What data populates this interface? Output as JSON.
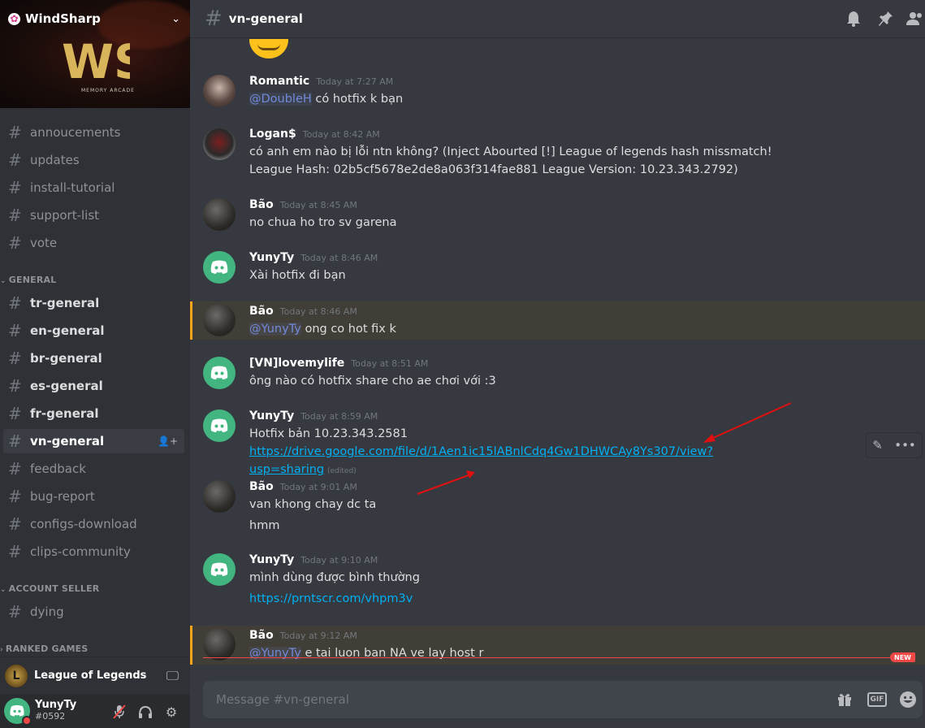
{
  "server": {
    "name": "WindSharp",
    "banner_text": "WS",
    "banner_sub": "MEMORY ARCADE"
  },
  "sidebar": {
    "top_channels": [
      {
        "name": "annoucements"
      },
      {
        "name": "updates"
      },
      {
        "name": "install-tutorial"
      },
      {
        "name": "support-list"
      },
      {
        "name": "vote"
      }
    ],
    "category_general": "GENERAL",
    "general_channels": [
      {
        "name": "tr-general"
      },
      {
        "name": "en-general"
      },
      {
        "name": "br-general"
      },
      {
        "name": "es-general"
      },
      {
        "name": "fr-general"
      },
      {
        "name": "vn-general"
      },
      {
        "name": "feedback"
      },
      {
        "name": "bug-report"
      },
      {
        "name": "configs-download"
      },
      {
        "name": "clips-community"
      }
    ],
    "category_account_seller": "ACCOUNT SELLER",
    "account_seller_channels": [
      {
        "name": "dying"
      }
    ],
    "category_ranked_games": "RANKED GAMES"
  },
  "voice": {
    "game": "League of Legends"
  },
  "user": {
    "name": "YunyTy",
    "tag": "#0592"
  },
  "header": {
    "channel": "vn-general"
  },
  "messages": [
    {
      "author": "Romantic",
      "time": "Today at 7:27 AM",
      "mention": "@DoubleH",
      "text": " có hotfix k bạn"
    },
    {
      "author": "Logan$",
      "time": "Today at 8:42 AM",
      "text": "có anh em nào bị lỗi ntn không? (Inject Abourted [!] League of legends hash missmatch! League Hash: 02b5cf5678e2de8a063f314fae881 League Version: 10.23.343.2792)"
    },
    {
      "author": "Bão",
      "time": "Today at 8:45 AM",
      "text": "no chua ho tro sv garena"
    },
    {
      "author": "YunyTy",
      "time": "Today at 8:46 AM",
      "text": "Xài hotfix đi bạn"
    },
    {
      "author": "Bão",
      "time": "Today at 8:46 AM",
      "mention": "@YunyTy",
      "text": " ong co hot fix k"
    },
    {
      "author": "[VN]lovemylife",
      "time": "Today at 8:51 AM",
      "text": "ông nào có hotfix share cho ae chơi với :3"
    },
    {
      "author": "YunyTy",
      "time": "Today at 8:59 AM",
      "text": "Hotfix bản 10.23.343.2581",
      "link": "https://drive.google.com/file/d/1Aen1ic15lABnlCdq4Gw1DHWCAy8Ys307/view?usp=sharing",
      "edited": "(edited)"
    },
    {
      "author": "Bão",
      "time": "Today at 9:01 AM",
      "text": "van khong chay dc ta",
      "text2": "hmm"
    },
    {
      "author": "YunyTy",
      "time": "Today at 9:10 AM",
      "text": "mình dùng được bình thường",
      "link": "https://prntscr.com/vhpm3v"
    },
    {
      "author": "Bão",
      "time": "Today at 9:12 AM",
      "mention": "@YunyTy",
      "text": " e tai luon ban NA ve lay host r"
    }
  ],
  "new_badge": "NEW",
  "composer": {
    "placeholder": "Message #vn-general",
    "gif_label": "GIF"
  },
  "icons": {
    "hash": "#"
  }
}
